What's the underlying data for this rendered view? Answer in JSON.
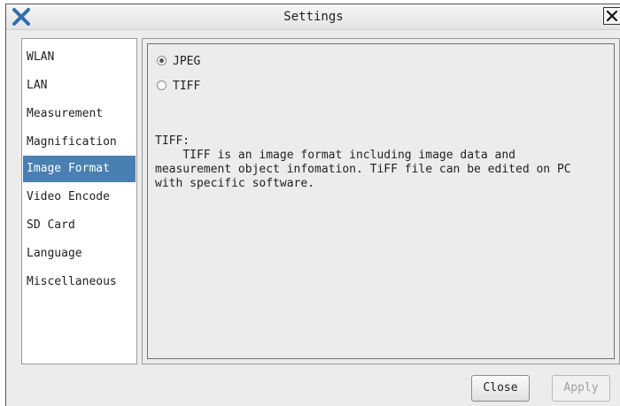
{
  "window": {
    "title": "Settings",
    "app_icon": "app-logo-icon",
    "close_icon": "close-icon"
  },
  "sidebar": {
    "items": [
      {
        "label": "WLAN",
        "selected": false
      },
      {
        "label": "LAN",
        "selected": false
      },
      {
        "label": "Measurement",
        "selected": false
      },
      {
        "label": "Magnification",
        "selected": false
      },
      {
        "label": "Image Format",
        "selected": true
      },
      {
        "label": "Video Encode",
        "selected": false
      },
      {
        "label": "SD Card",
        "selected": false
      },
      {
        "label": "Language",
        "selected": false
      },
      {
        "label": "Miscellaneous",
        "selected": false
      }
    ]
  },
  "image_format": {
    "options": [
      {
        "label": "JPEG",
        "checked": true
      },
      {
        "label": "TIFF",
        "checked": false
      }
    ],
    "description_heading": "TIFF:",
    "description_body": "    TIFF is an image format including image data and\nmeasurement object infomation. TiFF file can be edited on PC\nwith specific software."
  },
  "buttons": {
    "close_label": "Close",
    "apply_label": "Apply",
    "apply_enabled": false
  },
  "colors": {
    "selection": "#4a7fb2",
    "app_icon_blue": "#2f6fb0"
  }
}
